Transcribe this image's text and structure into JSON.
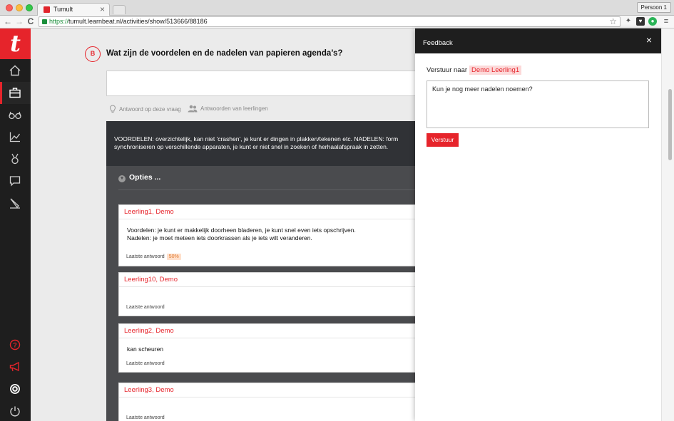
{
  "browser": {
    "tab_title": "Tumult",
    "tab_close": "×",
    "person_label": "Persoon 1",
    "url_scheme": "https://",
    "url_rest": "tumult.learnbeat.nl/activities/show/513666/88186"
  },
  "sidebar": {
    "logo": "t",
    "items": [
      {
        "name": "home-icon"
      },
      {
        "name": "briefcase-icon",
        "active": true
      },
      {
        "name": "glasses-icon"
      },
      {
        "name": "chart-icon"
      },
      {
        "name": "medal-icon"
      },
      {
        "name": "chat-icon"
      },
      {
        "name": "pencil-icon"
      }
    ],
    "bottom_items": [
      {
        "name": "help-icon"
      },
      {
        "name": "megaphone-icon"
      },
      {
        "name": "badge-icon"
      },
      {
        "name": "power-icon"
      }
    ]
  },
  "question": {
    "badge": "B",
    "title": "Wat zijn de voordelen en de nadelen van papieren agenda’s?",
    "input_value": ""
  },
  "helpers": {
    "answer_this": "Antwoord op deze vraag",
    "student_answers": "Antwoorden van leerlingen"
  },
  "model_answer": {
    "line1": "VOORDELEN: overzichtelijk, kan niet 'crashen', je kunt er dingen in plakken/tekenen etc. NADELEN: form",
    "line2": "synchroniseren op verschillende apparaten, je kunt er niet snel in zoeken of herhaalafspraak in zetten."
  },
  "options": {
    "label": "Opties ..."
  },
  "students": [
    {
      "name": "Leerling1, Demo",
      "line1": "Voordelen: je kunt er makkelijk doorheen bladeren, je kunt snel even iets opschrijven.",
      "line2": "Nadelen: je moet meteen iets doorkrassen als je iets wilt veranderen.",
      "meta": "Laatste antwoord",
      "score": "50%"
    },
    {
      "name": "Leerling10, Demo",
      "line1": "",
      "line2": "",
      "meta": "Laatste antwoord"
    },
    {
      "name": "Leerling2, Demo",
      "line1": "kan scheuren",
      "line2": "",
      "meta": "Laatste antwoord"
    },
    {
      "name": "Leerling3, Demo",
      "line1": "",
      "line2": "",
      "meta": "Laatste antwoord"
    }
  ],
  "feedback": {
    "title": "Feedback",
    "close": "×",
    "send_to_label": "Verstuur naar",
    "recipient": "Demo Leerling1",
    "message": "Kun je nog meer nadelen noemen?",
    "send_button": "Verstuur"
  },
  "colors": {
    "accent": "#e6242b",
    "sidebar_bg": "#1e1e1e",
    "panel_bg": "#4a4b4e"
  }
}
